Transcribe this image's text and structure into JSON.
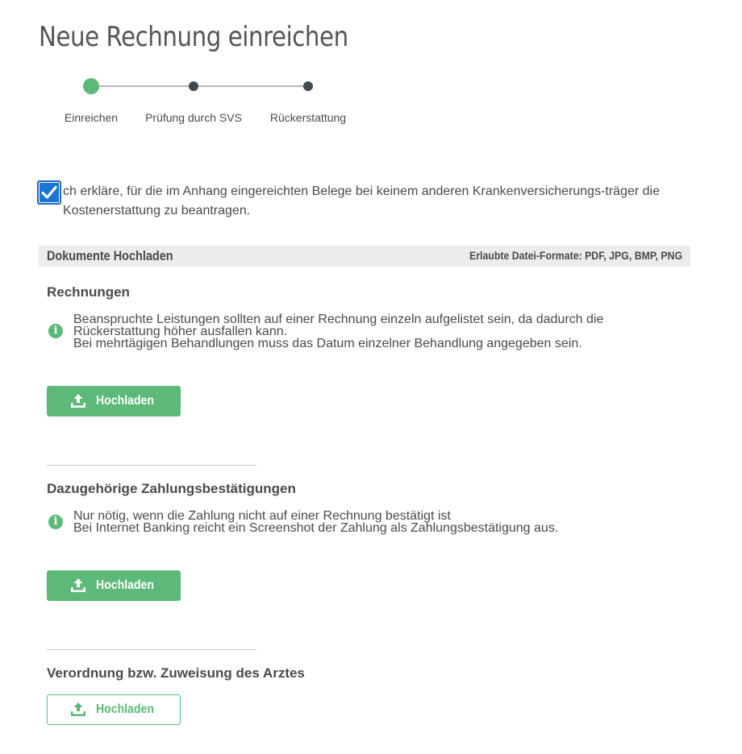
{
  "page": {
    "title": "Neue Rechnung einreichen"
  },
  "stepper": {
    "steps": [
      {
        "label": "Einreichen",
        "state": "active"
      },
      {
        "label": "Prüfung durch SVS",
        "state": "pending"
      },
      {
        "label": "Rückerstattung",
        "state": "pending"
      }
    ]
  },
  "declaration": {
    "checked": true,
    "text": "ch erkläre, für die im Anhang eingereichten Belege bei keinem anderen Krankenversicherungs-träger die Kostenerstattung zu beantragen."
  },
  "documents": {
    "title": "Dokumente Hochladen",
    "formats": "Erlaubte Datei-Formate: PDF, JPG, BMP, PNG"
  },
  "sections": [
    {
      "heading": "Rechnungen",
      "info_lines": [
        "Beanspruchte Leistungen sollten auf einer Rechnung einzeln aufgelistet sein, da dadurch die Rückerstattung höher ausfallen kann.",
        "Bei mehrtägigen Behandlungen muss das Datum einzelner Behandlung angegeben sein."
      ],
      "button_label": "Hochladen"
    },
    {
      "heading": "Dazugehörige Zahlungsbestätigungen",
      "info_lines": [
        "Nur nötig, wenn die Zahlung nicht auf einer Rechnung bestätigt ist",
        "Bei Internet Banking reicht ein Screenshot der Zahlung als Zahlungsbestätigung aus."
      ],
      "button_label": "Hochladen"
    },
    {
      "heading": "Verordnung bzw. Zuweisung des Arztes",
      "button_label": "Hochladen"
    }
  ],
  "colors": {
    "accent_green": "#5cb97a",
    "checkbox_blue": "#1976d2",
    "step_pending": "#3f4a4f",
    "section_bar": "#ececec"
  },
  "icons": {
    "info": "info-circle-icon",
    "upload": "upload-icon",
    "check": "check-icon"
  }
}
